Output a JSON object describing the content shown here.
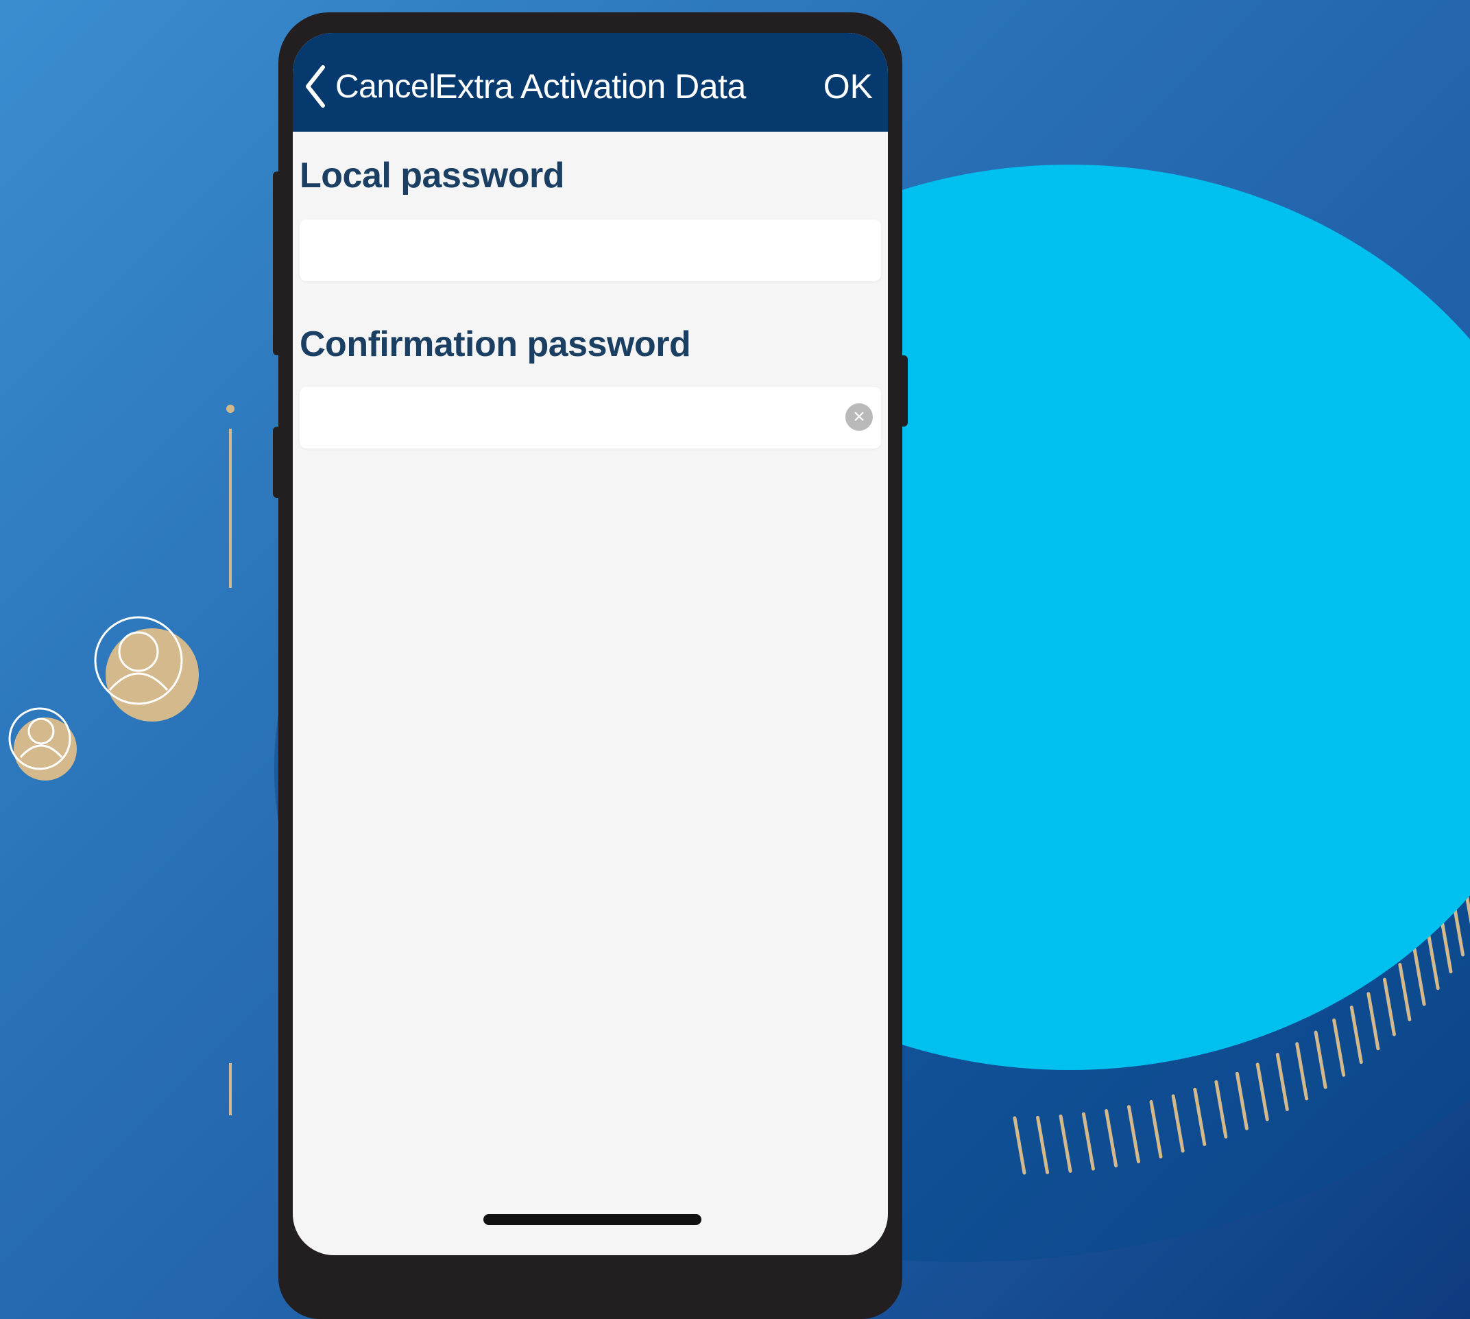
{
  "colors": {
    "background": "#2a72b8",
    "accent_circle": "#00c0f0",
    "gold": "#d4b98c",
    "nav_bar": "#063a6e",
    "label_text": "#1b3f62",
    "phone_frame": "#231f20"
  },
  "nav": {
    "back_icon": "chevron-left-icon",
    "cancel_label": "Cancel",
    "title": "Extra Activation Data",
    "ok_label": "OK"
  },
  "form": {
    "local_password": {
      "label": "Local password",
      "value": ""
    },
    "confirmation_password": {
      "label": "Confirmation password",
      "value": "",
      "clear_icon": "clear-circle-icon"
    }
  },
  "decorations": {
    "user_icons": [
      "user-icon",
      "user-icon"
    ]
  }
}
